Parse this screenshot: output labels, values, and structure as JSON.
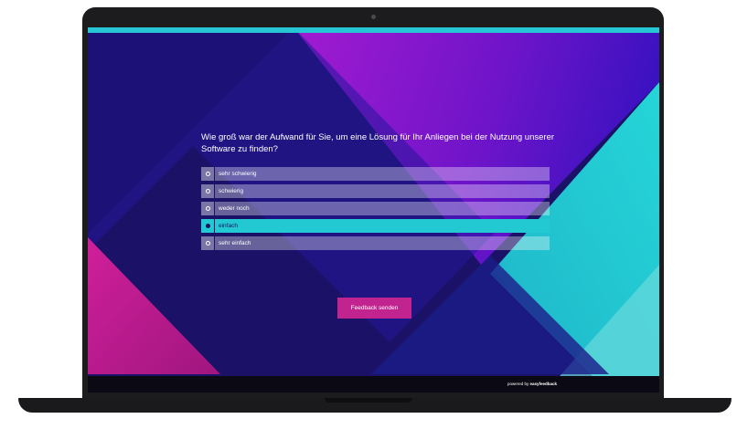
{
  "survey": {
    "question": "Wie groß war der Aufwand für Sie, um eine Lösung für Ihr Anliegen bei der Nutzung unserer Software zu finden?",
    "options": [
      {
        "label": "sehr schwierig",
        "selected": false
      },
      {
        "label": "schwierig",
        "selected": false
      },
      {
        "label": "weder noch",
        "selected": false
      },
      {
        "label": "einfach",
        "selected": true
      },
      {
        "label": "sehr einfach",
        "selected": false
      }
    ],
    "submit_label": "Feedback senden"
  },
  "footer": {
    "powered_prefix": "powered by",
    "brand": "easyfeedback"
  },
  "colors": {
    "accent_cyan": "#22c9d3",
    "button_magenta": "#c2248f",
    "background_navy": "#1a1160"
  }
}
